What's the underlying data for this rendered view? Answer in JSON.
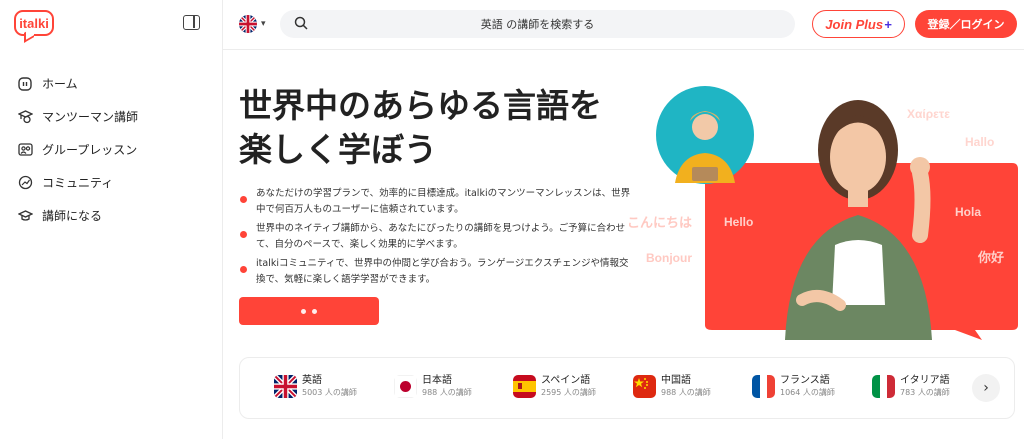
{
  "app": {
    "logo_text": "italki"
  },
  "sidebar": {
    "items": [
      {
        "label": "ホーム",
        "icon": "home-icon"
      },
      {
        "label": "マンツーマン講師",
        "icon": "tutor-icon"
      },
      {
        "label": "グループレッスン",
        "icon": "group-icon"
      },
      {
        "label": "コミュニティ",
        "icon": "community-icon"
      },
      {
        "label": "講師になる",
        "icon": "graduation-cap-icon"
      }
    ]
  },
  "header": {
    "search_placeholder": "英語 の講師を検索する",
    "join_label": "Join Plus",
    "join_plus_mark": "+",
    "login_label": "登録／ログイン"
  },
  "hero": {
    "title_line1": "世界中のあらゆる言語を",
    "title_line2": "楽しく学ぼう",
    "bullets": [
      "あなただけの学習プランで、効率的に目標達成。italkiのマンツーマンレッスンは、世界中で何百万人ものユーザーに信頼されています。",
      "世界中のネイティブ講師から、あなたにぴったりの講師を見つけよう。ご予算に合わせて、自分のペースで、楽しく効果的に学べます。",
      "italkiコミュニティで、世界中の仲間と学び合おう。ランゲージエクスチェンジや情報交換で、気軽に楽しく語学学習ができます。"
    ],
    "greetings": [
      "Χαίρετε",
      "Hallo",
      "こんにちは",
      "Hello",
      "Hola",
      "Bonjour",
      "你好"
    ]
  },
  "languages": [
    {
      "name": "英語",
      "count": "5003 人の講師",
      "flag": "uk-flag-icon"
    },
    {
      "name": "日本語",
      "count": "988 人の講師",
      "flag": "japan-flag-icon"
    },
    {
      "name": "スペイン語",
      "count": "2595 人の講師",
      "flag": "spain-flag-icon"
    },
    {
      "name": "中国語",
      "count": "988 人の講師",
      "flag": "china-flag-icon"
    },
    {
      "name": "フランス語",
      "count": "1064 人の講師",
      "flag": "france-flag-icon"
    },
    {
      "name": "イタリア語",
      "count": "783 人の講師",
      "flag": "italy-flag-icon"
    }
  ],
  "colors": {
    "accent": "#ff4438",
    "plus": "#4a2fe0",
    "teal": "#1fb5c4"
  }
}
